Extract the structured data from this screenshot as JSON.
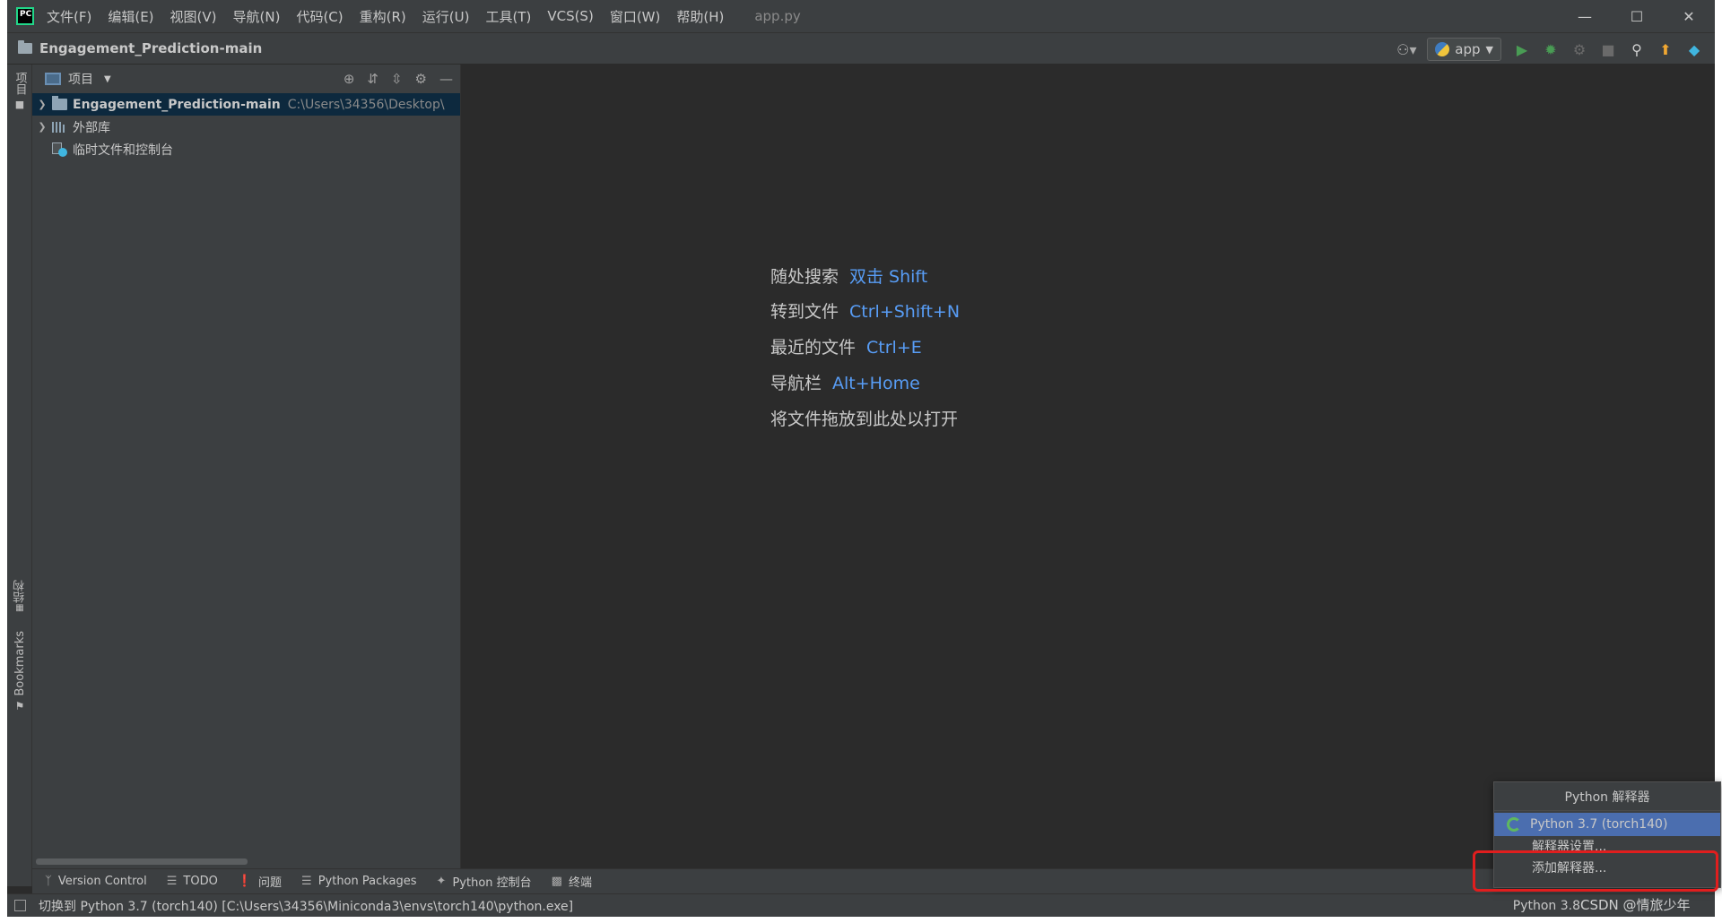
{
  "menubar": {
    "items": [
      "文件(F)",
      "编辑(E)",
      "视图(V)",
      "导航(N)",
      "代码(C)",
      "重构(R)",
      "运行(U)",
      "工具(T)",
      "VCS(S)",
      "窗口(W)",
      "帮助(H)"
    ],
    "current_file": "app.py",
    "window_controls": {
      "minimize": "—",
      "maximize": "☐",
      "close": "✕"
    }
  },
  "navbar": {
    "project_name": "Engagement_Prediction-main",
    "run_config": "app"
  },
  "left_strip": {
    "project_tab": "项目",
    "structure_tab": "结构",
    "bookmarks_tab": "Bookmarks"
  },
  "project_panel": {
    "title": "项目",
    "tree": [
      {
        "label": "Engagement_Prediction-main",
        "path": "C:\\Users\\34356\\Desktop\\"
      },
      {
        "label": "外部库"
      },
      {
        "label": "临时文件和控制台"
      }
    ]
  },
  "editor": {
    "hints": [
      {
        "label": "随处搜索",
        "key": "双击 Shift"
      },
      {
        "label": "转到文件",
        "key": "Ctrl+Shift+N"
      },
      {
        "label": "最近的文件",
        "key": "Ctrl+E"
      },
      {
        "label": "导航栏",
        "key": "Alt+Home"
      }
    ],
    "drop_hint": "将文件拖放到此处以打开"
  },
  "bottom_bar": {
    "items": [
      "Version Control",
      "TODO",
      "问题",
      "Python Packages",
      "Python 控制台",
      "终端"
    ]
  },
  "status_bar": {
    "message": "切换到 Python 3.7 (torch140) [C:\\Users\\34356\\Miniconda3\\envs\\torch140\\python.exe]",
    "interpreter": "Python 3.8"
  },
  "interpreter_popup": {
    "title": "Python 解释器",
    "selected": "Python 3.7 (torch140)",
    "settings": "解释器设置...",
    "add": "添加解释器..."
  },
  "watermark": "CSDN @情旅少年",
  "colors": {
    "background": "#2b2b2b",
    "panel": "#3c3f41",
    "accent_key": "#589df6",
    "selection": "#4b6eaf",
    "highlight_box": "#e01e1e"
  }
}
